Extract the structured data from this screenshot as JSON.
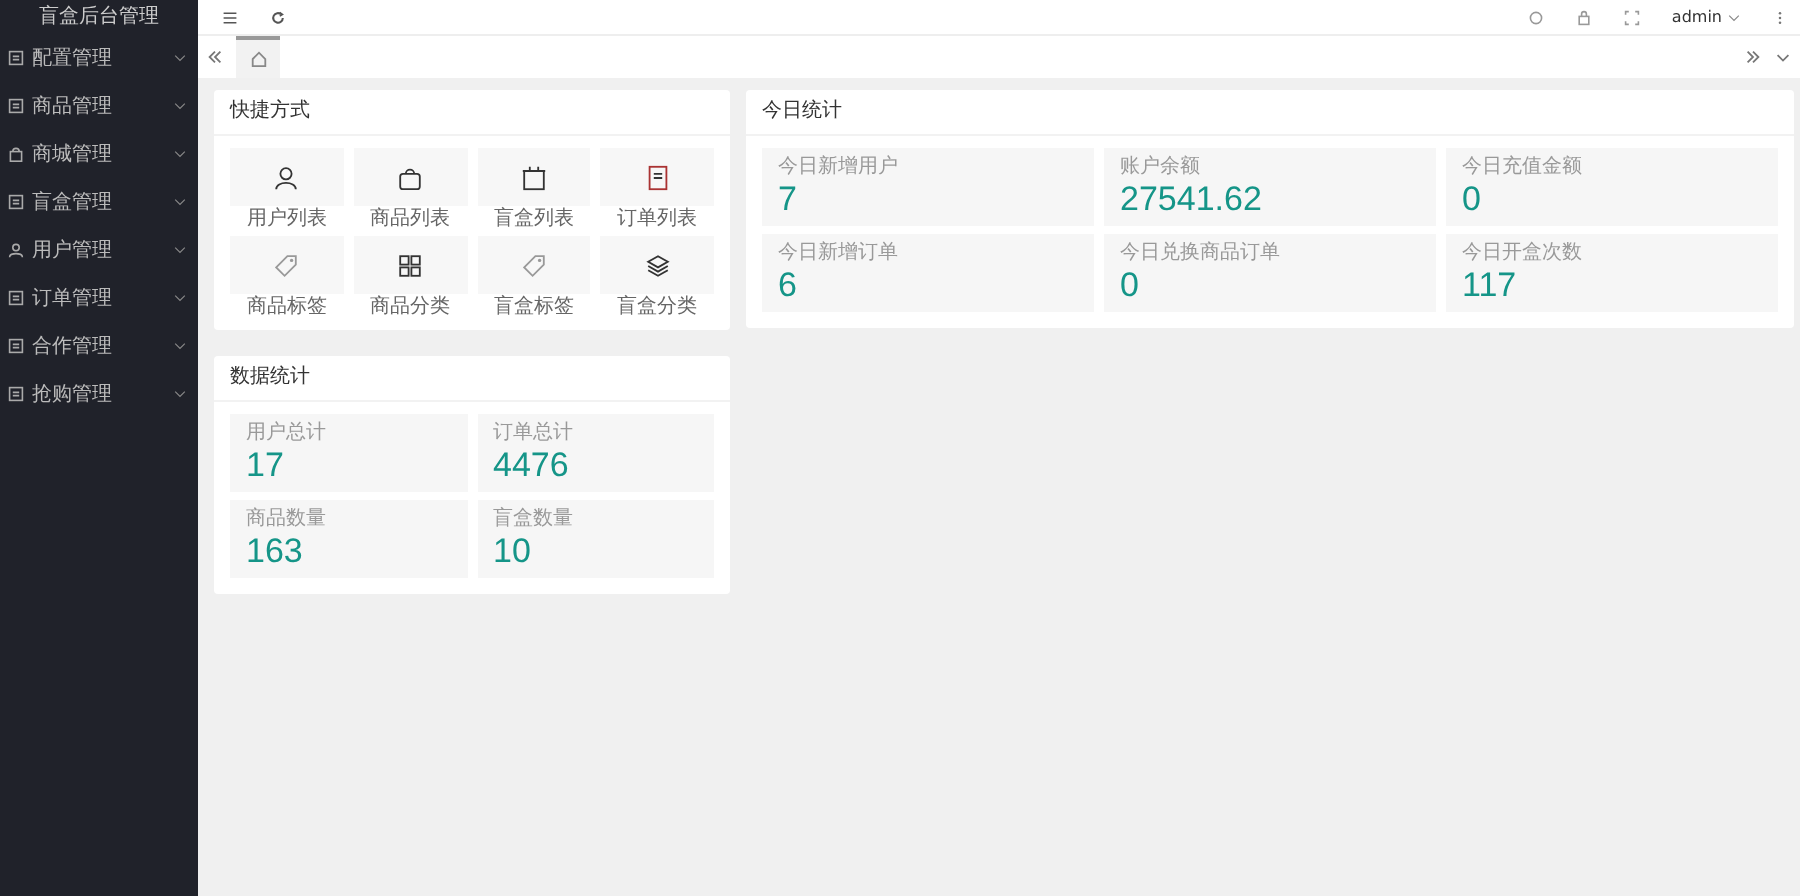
{
  "sidebar": {
    "title": "盲盒后台管理",
    "items": [
      {
        "label": "配置管理",
        "kind": "config",
        "expanded": false
      },
      {
        "label": "商品管理",
        "kind": "goods",
        "expanded": false
      },
      {
        "label": "商城管理",
        "kind": "shop",
        "expanded": false
      },
      {
        "label": "盲盒管理",
        "kind": "box",
        "expanded": false
      },
      {
        "label": "用户管理",
        "kind": "user",
        "expanded": false
      },
      {
        "label": "订单管理",
        "kind": "order",
        "expanded": false
      },
      {
        "label": "合作管理",
        "kind": "coop",
        "expanded": false
      },
      {
        "label": "抢购管理",
        "kind": "coop",
        "expanded": false
      }
    ]
  },
  "header": {
    "user": "admin"
  },
  "tabs": [
    {
      "kind": "home",
      "selected": true
    }
  ],
  "quick": {
    "title": "快捷方式",
    "items": [
      {
        "label": "用户列表",
        "kind": "user"
      },
      {
        "label": "商品列表",
        "kind": "bag"
      },
      {
        "label": "盲盒列表",
        "kind": "calendar"
      },
      {
        "label": "订单列表",
        "kind": "doc"
      },
      {
        "label": "商品标签",
        "kind": "tag"
      },
      {
        "label": "商品分类",
        "kind": "grid"
      },
      {
        "label": "盲盒标签",
        "kind": "tag"
      },
      {
        "label": "盲盒分类",
        "kind": "layers"
      }
    ]
  },
  "today": {
    "title": "今日统计",
    "items": [
      {
        "label": "今日新增用户",
        "value": "7"
      },
      {
        "label": "账户余额",
        "value": "27541.62"
      },
      {
        "label": "今日充值金额",
        "value": "0"
      },
      {
        "label": "今日新增订单",
        "value": "6"
      },
      {
        "label": "今日兑换商品订单",
        "value": "0"
      },
      {
        "label": "今日开盒次数",
        "value": "117"
      }
    ]
  },
  "data": {
    "title": "数据统计",
    "items": [
      {
        "label": "用户总计",
        "value": "17"
      },
      {
        "label": "订单总计",
        "value": "4476"
      },
      {
        "label": "商品数量",
        "value": "163"
      },
      {
        "label": "盲盒数量",
        "value": "10"
      }
    ]
  }
}
